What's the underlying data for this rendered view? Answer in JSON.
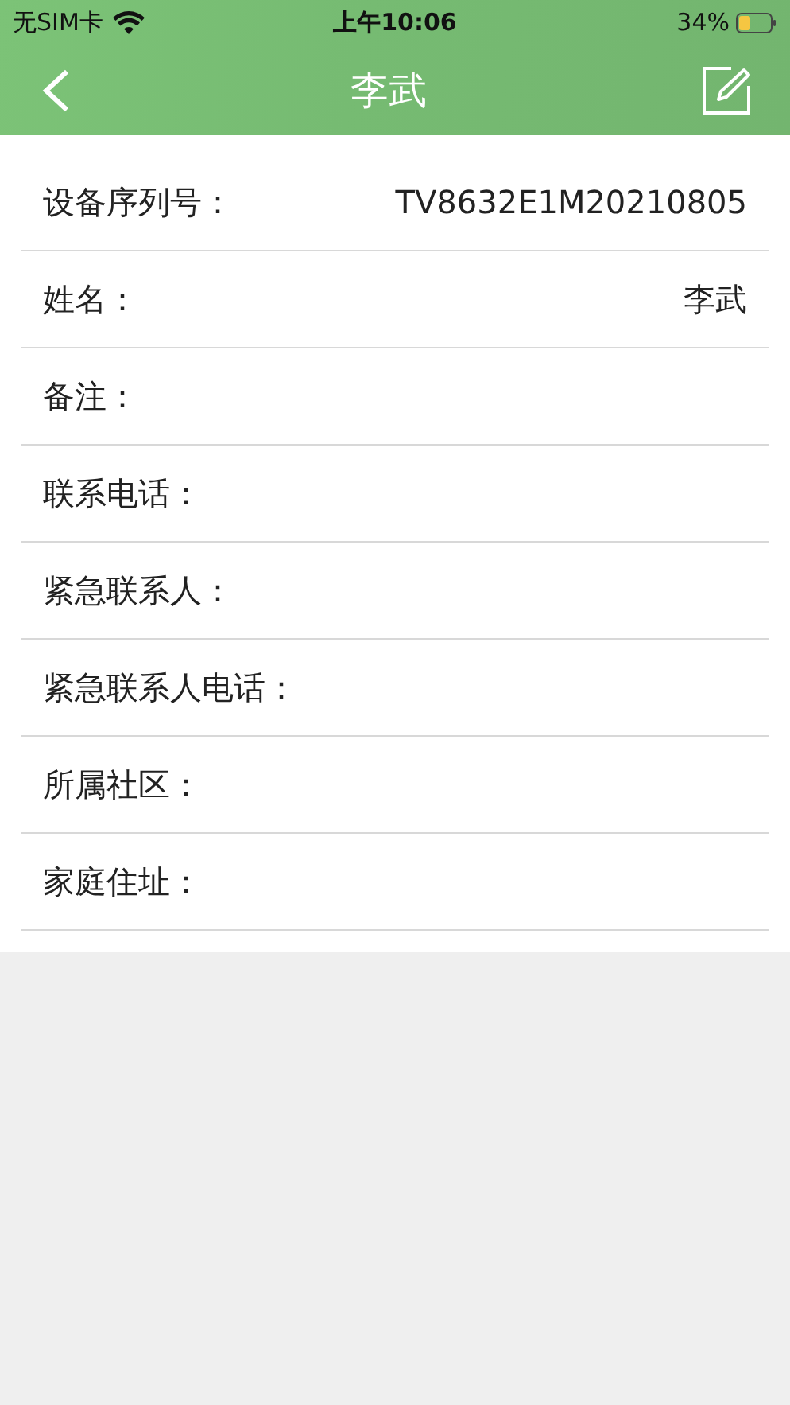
{
  "status_bar": {
    "carrier": "无SIM卡",
    "time": "上午10:06",
    "battery": "34%"
  },
  "nav": {
    "title": "李武"
  },
  "fields": [
    {
      "label": "设备序列号：",
      "value": "TV8632E1M20210805"
    },
    {
      "label": "姓名：",
      "value": "李武"
    },
    {
      "label": "备注："
    },
    {
      "label": "联系电话："
    },
    {
      "label": "紧急联系人："
    },
    {
      "label": "紧急联系人电话："
    },
    {
      "label": "所属社区："
    },
    {
      "label": "家庭住址："
    }
  ]
}
